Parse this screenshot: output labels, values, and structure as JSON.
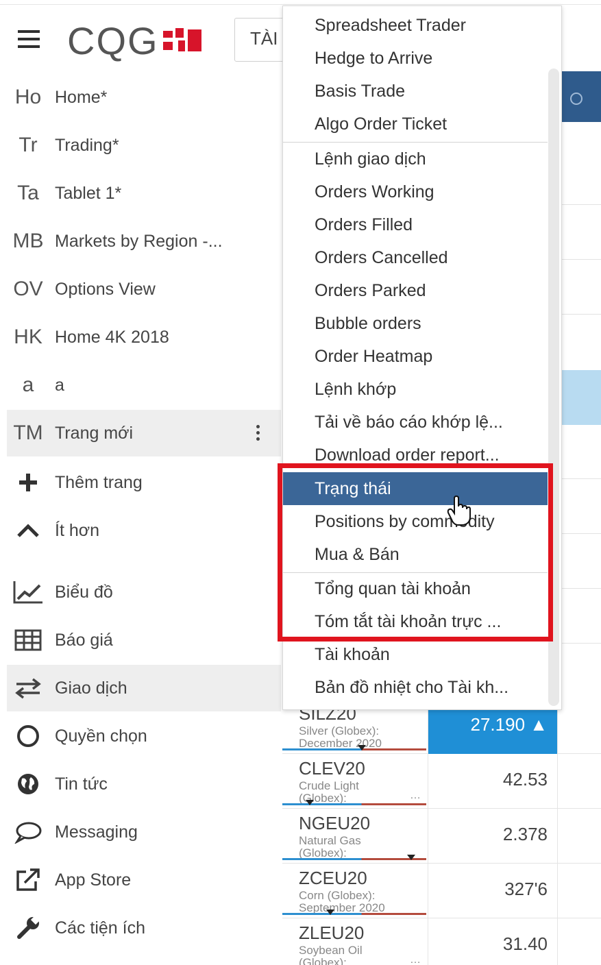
{
  "header": {
    "logo_text": "CQG",
    "tab_label": "TÀI"
  },
  "sidebar": {
    "items": [
      {
        "abbr": "Ho",
        "label": "Home*"
      },
      {
        "abbr": "Tr",
        "label": "Trading*"
      },
      {
        "abbr": "Ta",
        "label": "Tablet 1*"
      },
      {
        "abbr": "MB",
        "label": "Markets by Region -..."
      },
      {
        "abbr": "OV",
        "label": "Options View"
      },
      {
        "abbr": "HK",
        "label": "Home 4K 2018"
      },
      {
        "abbr": "a",
        "label": "a"
      },
      {
        "abbr": "TM",
        "label": "Trang mới"
      }
    ],
    "actions": [
      {
        "icon": "plus-icon",
        "label": "Thêm trang"
      },
      {
        "icon": "chevron-up-icon",
        "label": "Ít hơn"
      }
    ],
    "tools": [
      {
        "icon": "chart-icon",
        "label": "Biểu đồ"
      },
      {
        "icon": "table-grid-icon",
        "label": "Báo giá"
      },
      {
        "icon": "swap-arrows-icon",
        "label": "Giao dịch"
      },
      {
        "icon": "circle-icon",
        "label": "Quyền chọn"
      },
      {
        "icon": "globe-icon",
        "label": "Tin tức"
      },
      {
        "icon": "speech-bubble-icon",
        "label": "Messaging"
      },
      {
        "icon": "external-link-icon",
        "label": "App Store"
      },
      {
        "icon": "wrench-icon",
        "label": "Các tiện ích"
      }
    ]
  },
  "menu": {
    "items": [
      "Spreadsheet Trader",
      "Hedge to Arrive",
      "Basis Trade",
      "Algo Order Ticket",
      "Lệnh giao dịch",
      "Orders Working",
      "Orders Filled",
      "Orders Cancelled",
      "Orders Parked",
      "Bubble orders",
      "Order Heatmap",
      "Lệnh khớp",
      "Tải về báo cáo khớp lệ...",
      "Download order report...",
      "Trạng thái",
      "Positions by commodity",
      "Mua & Bán",
      "Tổng quan tài khoản",
      "Tóm tắt tài khoản trực ...",
      "Tài khoản",
      "Bản đồ nhiệt cho Tài kh..."
    ],
    "selected": "Trạng thái"
  },
  "markets": [
    {
      "symbol": "SILZ20",
      "desc_line1": "Silver (Globex):",
      "desc_line2": "December 2020",
      "value": "27.190 ▲"
    },
    {
      "symbol": "CLEV20",
      "desc_line1": "Crude Light",
      "desc_line2": "(Globex):",
      "value": "42.53"
    },
    {
      "symbol": "NGEU20",
      "desc_line1": "Natural Gas",
      "desc_line2": "(Globex):",
      "value": "2.378"
    },
    {
      "symbol": "ZCEU20",
      "desc_line1": "Corn (Globex):",
      "desc_line2": "September 2020",
      "value": "327'6"
    },
    {
      "symbol": "ZLEU20",
      "desc_line1": "Soybean Oil",
      "desc_line2": "(Globex):",
      "value": "31.40"
    }
  ],
  "colors": {
    "menu_selected": "#3b6697",
    "highlight_box": "#e0141e",
    "price_highlight": "#1f8fd6",
    "brand_red": "#d7142a"
  }
}
